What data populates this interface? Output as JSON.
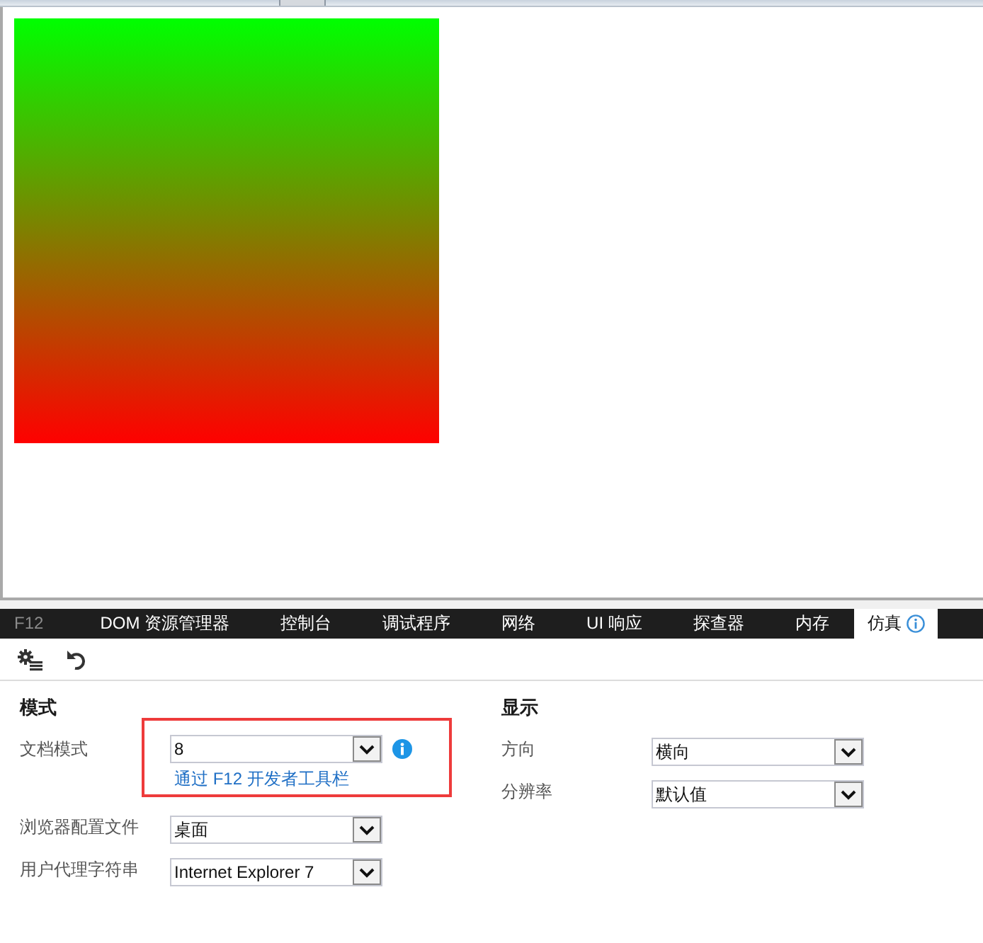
{
  "devtools": {
    "caption": "F12",
    "tabs": [
      {
        "label": "DOM 资源管理器",
        "kind": "tab",
        "selected": false
      },
      {
        "label": "控制台",
        "kind": "tab",
        "selected": false
      },
      {
        "label": "调试程序",
        "kind": "tab",
        "selected": false
      },
      {
        "label": "网络",
        "kind": "tab",
        "selected": false
      },
      {
        "label": "UI 响应",
        "kind": "tab",
        "selected": false
      },
      {
        "label": "探查器",
        "kind": "tab",
        "selected": false
      },
      {
        "label": "内存",
        "kind": "tab",
        "selected": false
      },
      {
        "label": "仿真",
        "kind": "infotab",
        "selected": true
      }
    ]
  },
  "sections": [
    {
      "title": "模式",
      "fields": [
        {
          "label": "文档模式",
          "value": "8",
          "highlighted": true,
          "link": "通过 F12 开发者工具栏"
        },
        {
          "label": "浏览器配置文件",
          "value": "桌面",
          "highlighted": false
        },
        {
          "label": "用户代理字符串",
          "value": "Internet Explorer 7",
          "highlighted": false
        }
      ]
    },
    {
      "title": "显示",
      "fields": [
        {
          "label": "方向",
          "value": "横向",
          "highlighted": false
        },
        {
          "label": "分辨率",
          "value": "默认值",
          "highlighted": false
        }
      ]
    }
  ]
}
